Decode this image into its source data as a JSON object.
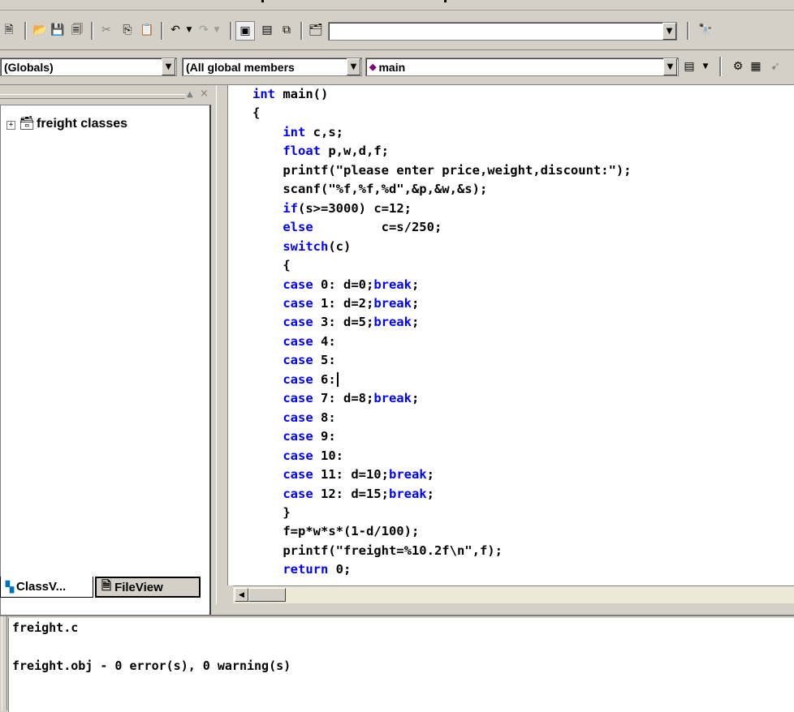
{
  "toolbar_standard": {
    "icons": [
      "new-text-file",
      "open",
      "save",
      "save-all",
      "cut",
      "copy",
      "paste",
      "undo",
      "redo",
      "workspace",
      "output",
      "window-list",
      "find-in-files",
      "find",
      "search-combo"
    ],
    "find_value": ""
  },
  "toolbar_wizard": {
    "scope": "(Globals)",
    "members": "(All global members",
    "function": "main",
    "function_symbol": "◆"
  },
  "workspace": {
    "tree_root": "freight classes",
    "tabs": [
      {
        "label": "ClassV..."
      },
      {
        "label": "FileView"
      }
    ]
  },
  "editor": {
    "lines": [
      "int main()",
      "{",
      "    int c,s;",
      "    float p,w,d,f;",
      "    printf(\"please enter price,weight,discount:\");",
      "    scanf(\"%f,%f,%d\",&p,&w,&s);",
      "    if(s>=3000) c=12;",
      "    else         c=s/250;",
      "    switch(c)",
      "    {",
      "    case 0: d=0;break;",
      "    case 1: d=2;break;",
      "    case 3: d=5;break;",
      "    case 4:",
      "    case 5:",
      "    case 6:",
      "    case 7: d=8;break;",
      "    case 8:",
      "    case 9:",
      "    case 10:",
      "    case 11: d=10;break;",
      "    case 12: d=15;break;",
      "    }",
      "    f=p*w*s*(1-d/100);",
      "    printf(\"freight=%10.2f\\n\",f);",
      "    return 0;"
    ],
    "keywords": [
      "int",
      "float",
      "if",
      "else",
      "switch",
      "case",
      "break",
      "return"
    ],
    "cursor_line": 15,
    "keyword_color": "#0000ff"
  },
  "output": {
    "lines": [
      "freight.c",
      "",
      "freight.obj - 0 error(s), 0 warning(s)"
    ]
  }
}
